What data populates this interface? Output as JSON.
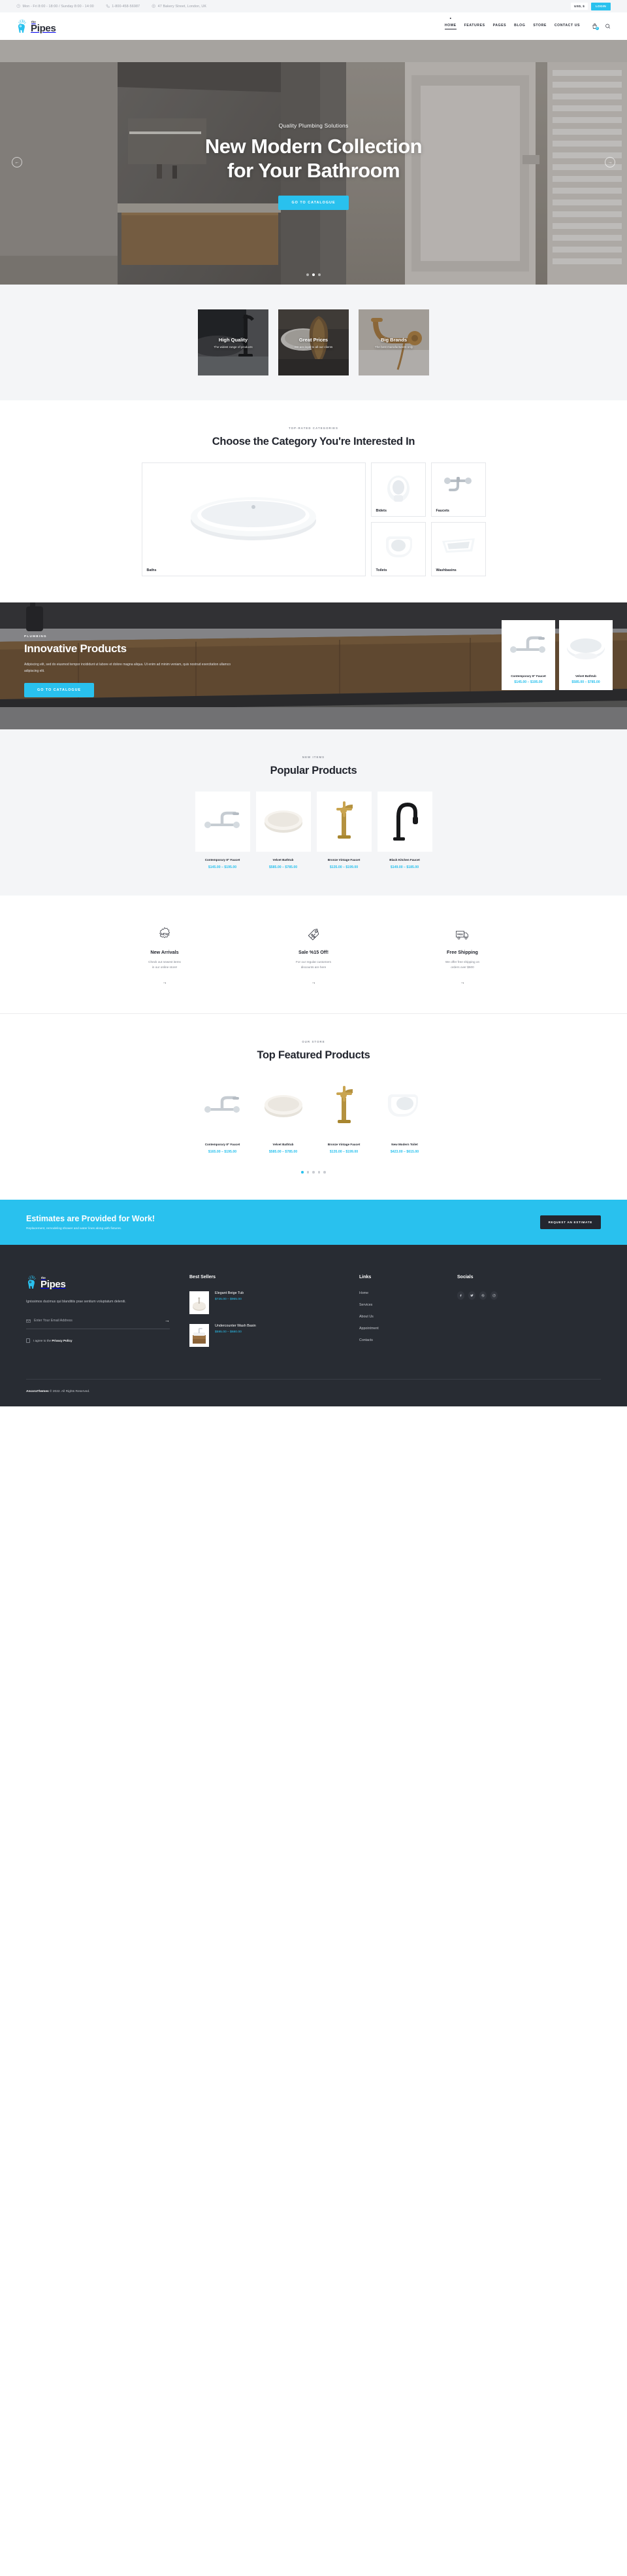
{
  "topbar": {
    "hours": "Mon - Fri 8:00 - 18:00 / Sunday 8:00 - 14:00",
    "phone": "1-800-458-56987",
    "address": "47 Bakery Street, London, UK",
    "currency": "USD, $",
    "login": "LOGIN"
  },
  "header": {
    "logo_the": "the",
    "logo_name": "Pipes",
    "nav": [
      {
        "label": "HOME",
        "active": true
      },
      {
        "label": "FEATURES",
        "active": false
      },
      {
        "label": "PAGES",
        "active": false
      },
      {
        "label": "BLOG",
        "active": false
      },
      {
        "label": "STORE",
        "active": false
      },
      {
        "label": "CONTACT US",
        "active": false
      }
    ],
    "cart_count": "0"
  },
  "hero": {
    "subtitle": "Quality Plumbing Solutions",
    "title_line1": "New Modern Collection",
    "title_line2": "for Your Bathroom",
    "cta": "GO TO CATALOGUE",
    "slides": 3,
    "active_slide": 1
  },
  "features": [
    {
      "title": "High Quality",
      "desc": "The widest range of products"
    },
    {
      "title": "Great Prices",
      "desc": "We are loyal to all our clients"
    },
    {
      "title": "Big Brands",
      "desc": "The best manufacturers only"
    }
  ],
  "categories_section": {
    "eyebrow": "TOP-RATED CATEGORIES",
    "title": "Choose the Category You're Interested In",
    "items": [
      {
        "label": "Baths"
      },
      {
        "label": "Bidets"
      },
      {
        "label": "Faucets"
      },
      {
        "label": "Toilets"
      },
      {
        "label": "Washbasins"
      }
    ]
  },
  "promo": {
    "eyebrow": "PLUMBING",
    "title": "Innovative Products",
    "desc": "Adipiscing elit, sed do eiusmod tempor incididunt ut labore et dolore magna aliqua. Ut enim ad minim veniam, quis nostrud exercitation ullamco adipiscing elit.",
    "cta": "GO TO CATALOGUE",
    "cards": [
      {
        "name": "Contemporary 8” Faucet",
        "price": "$145.00 – $195.00"
      },
      {
        "name": "Velvet Bathtub",
        "price": "$585.00 – $785.00"
      }
    ]
  },
  "popular": {
    "eyebrow": "NEW ITEMS",
    "title": "Popular Products",
    "items": [
      {
        "name": "Contemporary 8” Faucet",
        "price": "$145.00 – $195.00"
      },
      {
        "name": "Velvet Bathtub",
        "price": "$585.00 – $785.00"
      },
      {
        "name": "Bronze Vintage Faucet",
        "price": "$135.00 – $199.00"
      },
      {
        "name": "Black Kitchen Faucet",
        "price": "$149.00 – $185.00"
      }
    ]
  },
  "services": [
    {
      "icon": "new-badge-icon",
      "title": "New Arrivals",
      "line1": "Check out newest items",
      "line2": "in our online store!",
      "arrow": "→"
    },
    {
      "icon": "sale-tag-icon",
      "title": "Sale %15 Off!",
      "line1": "For our regular customers",
      "line2": "discounts are here",
      "arrow": "→"
    },
    {
      "icon": "free-shipping-truck-icon",
      "title": "Free Shipping",
      "line1": "We offer free shipping on",
      "line2": "orders over $500",
      "arrow": "→"
    }
  ],
  "featured": {
    "eyebrow": "OUR STORE",
    "title": "Top Featured Products",
    "items": [
      {
        "name": "Contemporary 8” Faucet",
        "price": "$165.00 – $195.00"
      },
      {
        "name": "Velvet Bathtub",
        "price": "$585.00 – $785.00"
      },
      {
        "name": "Bronze Vintage Faucet",
        "price": "$135.00 – $199.00"
      },
      {
        "name": "New Modern Toilet",
        "price": "$423.00 – $615.00"
      }
    ],
    "dots": 5,
    "active_dot": 1
  },
  "estimate": {
    "title": "Estimates are Provided for Work!",
    "subtitle": "Replacement, remodeling shower and water lines along with fixtures.",
    "button": "REQUEST AN ESTIMATE"
  },
  "footer": {
    "logo_the": "the",
    "logo_name": "Pipes",
    "about": "Ignissimos ducimus qui blanditiis prae sentium voluptatum deleniti.",
    "newsletter_placeholder": "Enter Your Email Address",
    "consent_prefix": "I agree to the ",
    "consent_link": "Privacy Policy",
    "best_sellers_title": "Best Sellers",
    "best_sellers": [
      {
        "name": "Elegant Beige Tub",
        "price": "$725.00 – $965.00"
      },
      {
        "name": "Undercounter Wash Basin",
        "price": "$595.00 – $680.00"
      }
    ],
    "links_title": "Links",
    "links": [
      "Home",
      "Services",
      "About Us",
      "Appointment",
      "Contacts"
    ],
    "socials_title": "Socials",
    "socials": [
      "facebook-icon",
      "twitter-icon",
      "dribbble-icon",
      "instagram-icon"
    ],
    "copyright_brand": "AncoraThemes",
    "copyright_rest": " © 2022. All Rights Reserved."
  },
  "colors": {
    "accent": "#29c1ee",
    "dark": "#282c33",
    "text": "#23262f",
    "muted": "#7e828c",
    "grey_bg": "#f4f5f7"
  }
}
